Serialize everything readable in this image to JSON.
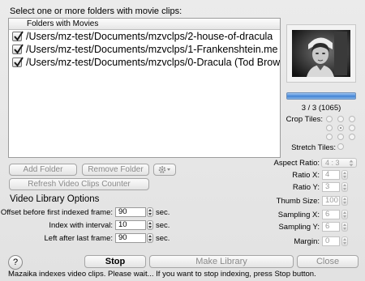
{
  "instruction": "Select one or more folders with movie clips:",
  "folders": {
    "header": "Folders with Movies",
    "rows": [
      {
        "checked": true,
        "path": "/Users/mz-test/Documents/mzvclps/2-house-of-dracula"
      },
      {
        "checked": true,
        "path": "/Users/mz-test/Documents/mzvclps/1-Frankenshtein.me"
      },
      {
        "checked": true,
        "path": "/Users/mz-test/Documents/mzvclps/0-Dracula (Tod Brow"
      }
    ]
  },
  "buttons": {
    "add_folder": "Add Folder",
    "remove_folder": "Remove Folder",
    "refresh": "Refresh Video Clips Counter",
    "stop": "Stop",
    "make_library": "Make Library",
    "close": "Close",
    "help": "?"
  },
  "options": {
    "title": "Video Library Options",
    "offset_label": "Offset before first indexed frame:",
    "offset_value": "90",
    "interval_label": "Index with interval:",
    "interval_value": "10",
    "left_label": "Left after last frame:",
    "left_value": "90",
    "unit": "sec."
  },
  "preview": {
    "progress": 1.0,
    "counter": "3 / 3 (1065)"
  },
  "tiles": {
    "crop_label": "Crop Tiles:",
    "stretch_label": "Stretch Tiles:",
    "aspect_label": "Aspect Ratio:",
    "aspect_value": "4 : 3",
    "ratio_x_label": "Ratio X:",
    "ratio_x_value": "4",
    "ratio_y_label": "Ratio Y:",
    "ratio_y_value": "3",
    "thumb_label": "Thumb Size:",
    "thumb_value": "100",
    "sampling_x_label": "Sampling X:",
    "sampling_x_value": "6",
    "sampling_y_label": "Sampling Y:",
    "sampling_y_value": "6",
    "margin_label": "Margin:",
    "margin_value": "0"
  },
  "status": "Mazaika indexes video clips. Please wait... If you want to stop indexing, press Stop button."
}
